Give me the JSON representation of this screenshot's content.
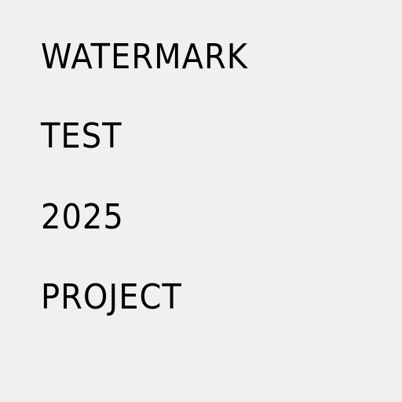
{
  "lines": [
    "WATERMARK",
    "TEST",
    "2025",
    "PROJECT"
  ]
}
